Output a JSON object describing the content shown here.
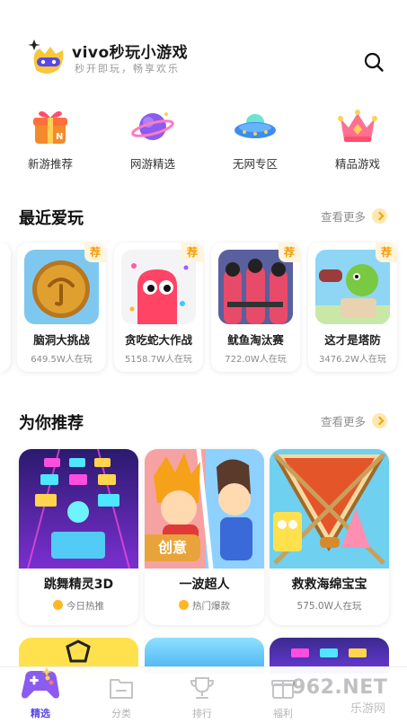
{
  "header": {
    "title": "vivo秒玩小游戏",
    "slogan": "秒开即玩，畅享欢乐",
    "search_icon": "search-icon"
  },
  "categories": [
    {
      "label": "新游推荐",
      "icon": "gift-box-icon"
    },
    {
      "label": "网游精选",
      "icon": "planet-icon"
    },
    {
      "label": "无网专区",
      "icon": "ufo-icon"
    },
    {
      "label": "精品游戏",
      "icon": "crown-icon"
    }
  ],
  "recent": {
    "title": "最近爱玩",
    "more": "查看更多",
    "tag": "荐",
    "items": [
      {
        "name": "脑洞大挑战",
        "plays": "649.5W人在玩"
      },
      {
        "name": "贪吃蛇大作战",
        "plays": "5158.7W人在玩"
      },
      {
        "name": "鱿鱼淘汰赛",
        "plays": "722.0W人在玩"
      },
      {
        "name": "这才是塔防",
        "plays": "3476.2W人在玩"
      }
    ]
  },
  "recommend": {
    "title": "为你推荐",
    "more": "查看更多",
    "creative_tag": "创意",
    "items": [
      {
        "name": "跳舞精灵3D",
        "meta": "今日热推",
        "fire": true
      },
      {
        "name": "一波超人",
        "meta": "热门爆款",
        "fire": true
      },
      {
        "name": "救救海绵宝宝",
        "meta": "575.0W人在玩",
        "fire": false
      }
    ]
  },
  "nav": [
    {
      "label": "精选",
      "icon": "gamepad-icon",
      "active": true
    },
    {
      "label": "分类",
      "icon": "folder-icon",
      "active": false
    },
    {
      "label": "排行",
      "icon": "trophy-icon",
      "active": false
    },
    {
      "label": "福利",
      "icon": "gift-icon",
      "active": false
    }
  ],
  "watermark": {
    "text": "962.NET",
    "sub": "乐游网"
  },
  "colors": {
    "accent": "#5a47e8",
    "tag_orange": "#f39a00",
    "more_dot": "#fde9b0"
  }
}
